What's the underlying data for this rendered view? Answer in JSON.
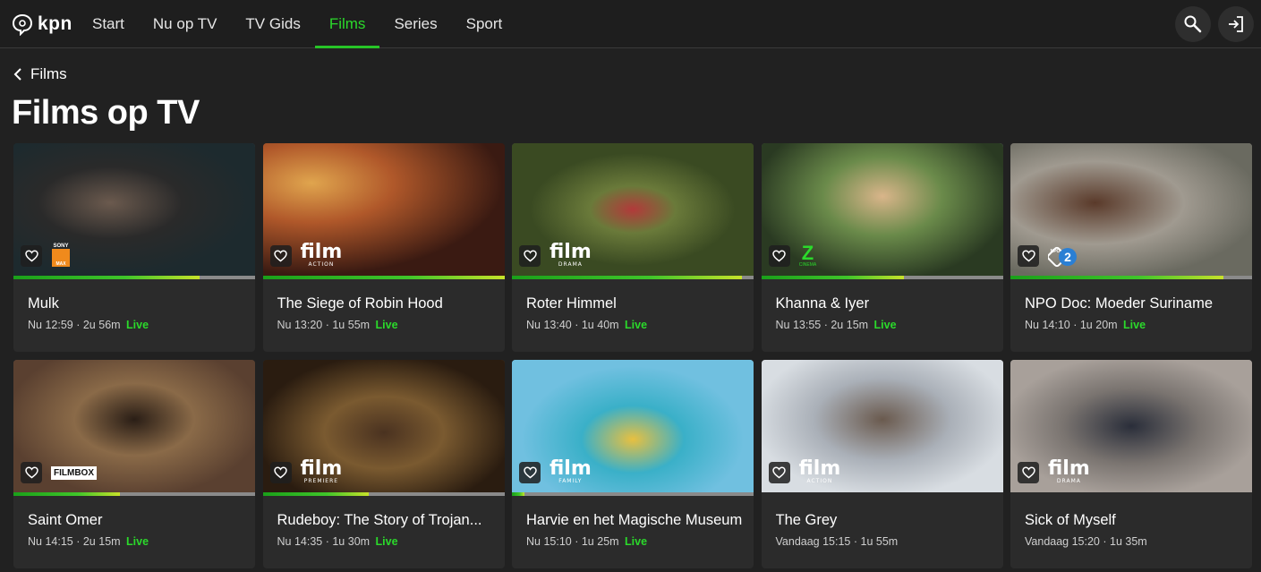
{
  "header": {
    "logo_text": "kpn",
    "nav": [
      {
        "label": "Start",
        "active": false
      },
      {
        "label": "Nu op TV",
        "active": false
      },
      {
        "label": "TV Gids",
        "active": false
      },
      {
        "label": "Films",
        "active": true
      },
      {
        "label": "Series",
        "active": false
      },
      {
        "label": "Sport",
        "active": false
      }
    ],
    "search_icon": "search-icon",
    "login_icon": "login-icon"
  },
  "breadcrumb": {
    "label": "Films"
  },
  "page_title": "Films op TV",
  "colors": {
    "accent": "#2bd92b",
    "background": "#212121",
    "card": "#2b2b2b"
  },
  "cards": [
    {
      "title": "Mulk",
      "time": "Nu 12:59",
      "duration": "2u 56m",
      "live": "Live",
      "channel": "sony-max",
      "channel_top": "SONY",
      "channel_sub": "MAX",
      "progress": 0.77
    },
    {
      "title": "The Siege of Robin Hood",
      "time": "Nu 13:20",
      "duration": "1u 55m",
      "live": "Live",
      "channel": "film",
      "channel_text": "film",
      "channel_sub": "ACTION",
      "progress": 1.0
    },
    {
      "title": "Roter Himmel",
      "time": "Nu 13:40",
      "duration": "1u 40m",
      "live": "Live",
      "channel": "film",
      "channel_text": "film",
      "channel_sub": "DRAMA",
      "progress": 0.95
    },
    {
      "title": "Khanna & Iyer",
      "time": "Nu 13:55",
      "duration": "2u 15m",
      "live": "Live",
      "channel": "zee",
      "channel_top": "Z",
      "channel_sub": "CINEMA",
      "progress": 0.59
    },
    {
      "title": "NPO Doc: Moeder Suriname",
      "time": "Nu 14:10",
      "duration": "1u 20m",
      "live": "Live",
      "channel": "npo2",
      "channel_top": "NPO",
      "channel_sub": "2",
      "progress": 0.88
    },
    {
      "title": "Saint Omer",
      "time": "Nu 14:15",
      "duration": "2u 15m",
      "live": "Live",
      "channel": "filmbox",
      "channel_text": "FILMBOX",
      "progress": 0.44
    },
    {
      "title": "Rudeboy: The Story of Trojan...",
      "time": "Nu 14:35",
      "duration": "1u 30m",
      "live": "Live",
      "channel": "film",
      "channel_text": "film",
      "channel_sub": "PREMIERE",
      "progress": 0.44
    },
    {
      "title": "Harvie en het Magische Museum",
      "time": "Nu 15:10",
      "duration": "1u 25m",
      "live": "Live",
      "channel": "film",
      "channel_text": "film",
      "channel_sub": "FAMILY",
      "progress": 0.05
    },
    {
      "title": "The Grey",
      "time": "Vandaag 15:15",
      "duration": "1u 55m",
      "live": "",
      "channel": "film",
      "channel_text": "film",
      "channel_sub": "ACTION",
      "progress": 0
    },
    {
      "title": "Sick of Myself",
      "time": "Vandaag 15:20",
      "duration": "1u 35m",
      "live": "",
      "channel": "film",
      "channel_text": "film",
      "channel_sub": "DRAMA",
      "progress": 0
    }
  ]
}
